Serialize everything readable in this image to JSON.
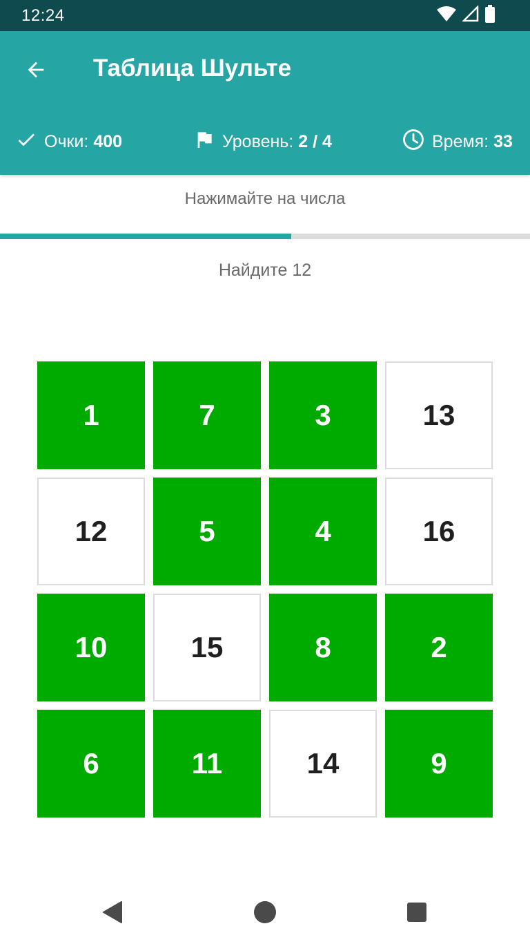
{
  "status_bar": {
    "time": "12:24",
    "icons": [
      "wifi-icon",
      "signal-icon",
      "battery-icon"
    ]
  },
  "app_bar": {
    "title": "Таблица Шульте",
    "back_icon": "arrow-back-icon",
    "stats": {
      "score": {
        "icon": "check-icon",
        "label": "Очки:",
        "value": "400"
      },
      "level": {
        "icon": "flag-icon",
        "label": "Уровень:",
        "value": "2 / 4"
      },
      "time": {
        "icon": "clock-icon",
        "label": "Время:",
        "value": "33"
      }
    }
  },
  "instruction": "Нажимайте на числа",
  "progress": {
    "fraction": 0.55
  },
  "prompt": "Найдите 12",
  "grid": {
    "cells": [
      {
        "number": "1",
        "found": true
      },
      {
        "number": "7",
        "found": true
      },
      {
        "number": "3",
        "found": true
      },
      {
        "number": "13",
        "found": false
      },
      {
        "number": "12",
        "found": false
      },
      {
        "number": "5",
        "found": true
      },
      {
        "number": "4",
        "found": true
      },
      {
        "number": "16",
        "found": false
      },
      {
        "number": "10",
        "found": true
      },
      {
        "number": "15",
        "found": false
      },
      {
        "number": "8",
        "found": true
      },
      {
        "number": "2",
        "found": true
      },
      {
        "number": "6",
        "found": true
      },
      {
        "number": "11",
        "found": true
      },
      {
        "number": "14",
        "found": false
      },
      {
        "number": "9",
        "found": true
      }
    ]
  },
  "colors": {
    "app_bar": "#26a5a5",
    "status_bar": "#0f4a4f",
    "found_cell": "#00ab00",
    "open_cell_border": "#dcdcdc"
  },
  "nav_bar": {
    "buttons": [
      "back-triangle-icon",
      "home-circle-icon",
      "recents-square-icon"
    ]
  }
}
